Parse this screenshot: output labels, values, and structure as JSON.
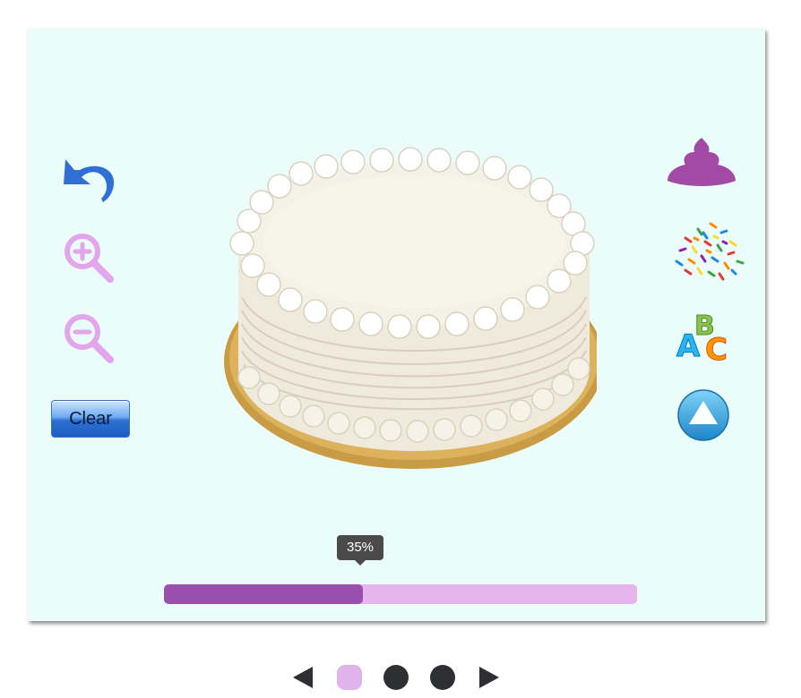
{
  "toolbar_left": {
    "undo_icon": "undo-arrow-icon",
    "zoom_in_icon": "zoom-in-icon",
    "zoom_out_icon": "zoom-out-icon",
    "clear_label": "Clear"
  },
  "toolbar_right": {
    "frosting_icon": "frosting-swirl-icon",
    "sprinkles_icon": "sprinkles-icon",
    "letters_icon": "abc-letters-icon",
    "up_icon": "up-arrow-icon"
  },
  "cake": {
    "description_icon": "white-frosted-cake-image"
  },
  "progress": {
    "label": "35%",
    "value": 0.42
  },
  "pager": {
    "prev_icon": "prev-arrow-icon",
    "next_icon": "next-arrow-icon",
    "pages": 3,
    "active_page": 1
  },
  "colors": {
    "panel_bg": "#ebfdfb",
    "progress_fill": "#9b4fac",
    "progress_track": "#e5b5ed",
    "zoom_icon": "#e3a6ec",
    "undo_icon": "#2f6fd6",
    "frosting": "#a24aa6"
  }
}
